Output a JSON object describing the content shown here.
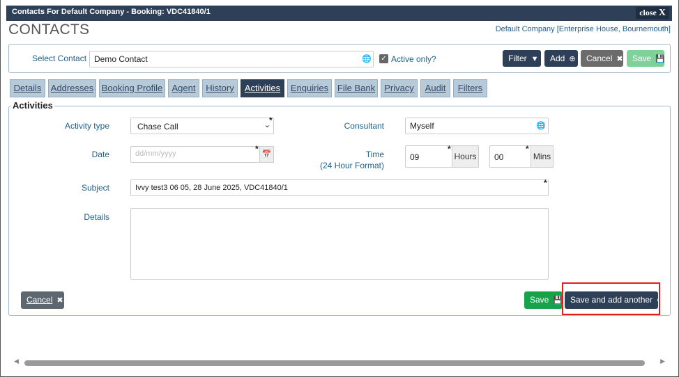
{
  "window": {
    "title": "Contacts For Default Company - Booking: VDC41840/1",
    "close_label": "close",
    "close_icon": "X"
  },
  "page": {
    "heading": "CONTACTS",
    "company": "Default Company [Enterprise House, Bournemouth]"
  },
  "select_bar": {
    "label": "Select Contact",
    "contact_value": "Demo Contact",
    "active_only_label": "Active only?",
    "active_only_checked": true,
    "buttons": {
      "filter": "Filter",
      "add": "Add",
      "cancel": "Cancel",
      "save": "Save"
    }
  },
  "tabs": [
    "Details",
    "Addresses",
    "Booking Profile",
    "Agent",
    "History",
    "Activities",
    "Enquiries",
    "File Bank",
    "Privacy",
    "Audit",
    "Filters"
  ],
  "active_tab": "Activities",
  "activities": {
    "legend": "Activities",
    "activity_type_label": "Activity type",
    "activity_type_value": "Chase Call",
    "consultant_label": "Consultant",
    "consultant_value": "Myself",
    "date_label": "Date",
    "date_placeholder": "dd/mm/yyyy",
    "time_label": "Time",
    "time_format_label": "(24 Hour Format)",
    "hours_value": "09",
    "hours_label": "Hours",
    "mins_value": "00",
    "mins_label": "Mins",
    "subject_label": "Subject",
    "subject_value": "Ivvy test3 06 05, 28 June 2025, VDC41840/1",
    "details_label": "Details",
    "details_value": "",
    "required_marker": "*"
  },
  "footer_buttons": {
    "cancel": "Cancel",
    "save": "Save",
    "save_and_add": "Save and add another"
  },
  "colors": {
    "titlebar": "#2e4057",
    "accent_blue": "#1e5f8a",
    "save_green": "#16a34a",
    "highlight_red": "#e11d1d"
  }
}
